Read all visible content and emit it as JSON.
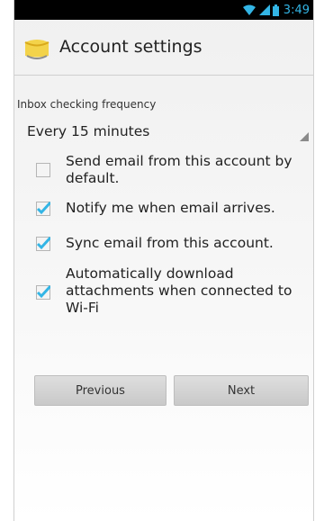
{
  "status_bar": {
    "time": "3:49"
  },
  "header": {
    "title": "Account settings"
  },
  "inbox_frequency": {
    "label": "Inbox checking frequency",
    "selected": "Every 15 minutes"
  },
  "options": [
    {
      "label": "Send email from this account by default.",
      "checked": false
    },
    {
      "label": "Notify me when email arrives.",
      "checked": true
    },
    {
      "label": "Sync email from this account.",
      "checked": true
    },
    {
      "label": "Automatically download attachments when connected to Wi-Fi",
      "checked": true
    }
  ],
  "buttons": {
    "previous": "Previous",
    "next": "Next"
  },
  "colors": {
    "accent": "#33b5e5",
    "checkbox_check": "#33b5e5"
  }
}
